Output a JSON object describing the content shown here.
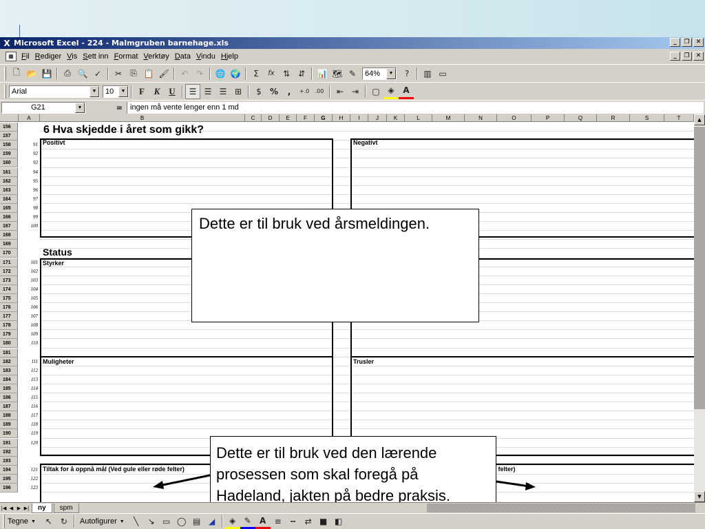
{
  "window": {
    "title": "Microsoft Excel - 224 - Malmgruben barnehage.xls",
    "minimize": "_",
    "restore": "❐",
    "close": "✕"
  },
  "menu": {
    "items": [
      "Fil",
      "Rediger",
      "Vis",
      "Sett inn",
      "Format",
      "Verktøy",
      "Data",
      "Vindu",
      "Hjelp"
    ]
  },
  "toolbar": {
    "zoom": "64%",
    "sum": "Σ",
    "fx": "fx"
  },
  "formatting": {
    "font": "Arial",
    "size": "10",
    "bold": "F",
    "italic": "K",
    "underline": "U",
    "percent": "%",
    "comma": ","
  },
  "formula_bar": {
    "cell_ref": "G21",
    "equals": "=",
    "value": "ingen må vente lenger enn 1 md"
  },
  "columns": [
    "A",
    "B",
    "C",
    "D",
    "E",
    "F",
    "G",
    "H",
    "I",
    "J",
    "K",
    "L",
    "M",
    "N",
    "O",
    "P",
    "Q",
    "R",
    "S",
    "T"
  ],
  "rows": [
    {
      "n": "156",
      "a": ""
    },
    {
      "n": "157",
      "a": ""
    },
    {
      "n": "158",
      "a": "91"
    },
    {
      "n": "159",
      "a": "92"
    },
    {
      "n": "160",
      "a": "93"
    },
    {
      "n": "161",
      "a": "94"
    },
    {
      "n": "162",
      "a": "95"
    },
    {
      "n": "163",
      "a": "96"
    },
    {
      "n": "164",
      "a": "97"
    },
    {
      "n": "165",
      "a": "98"
    },
    {
      "n": "166",
      "a": "99"
    },
    {
      "n": "167",
      "a": "100"
    },
    {
      "n": "168",
      "a": ""
    },
    {
      "n": "169",
      "a": ""
    },
    {
      "n": "170",
      "a": ""
    },
    {
      "n": "171",
      "a": "101"
    },
    {
      "n": "172",
      "a": "102"
    },
    {
      "n": "173",
      "a": "103"
    },
    {
      "n": "174",
      "a": "104"
    },
    {
      "n": "175",
      "a": "105"
    },
    {
      "n": "176",
      "a": "106"
    },
    {
      "n": "177",
      "a": "107"
    },
    {
      "n": "178",
      "a": "108"
    },
    {
      "n": "179",
      "a": "109"
    },
    {
      "n": "180",
      "a": "110"
    },
    {
      "n": "181",
      "a": ""
    },
    {
      "n": "182",
      "a": "111"
    },
    {
      "n": "183",
      "a": "112"
    },
    {
      "n": "184",
      "a": "113"
    },
    {
      "n": "185",
      "a": "114"
    },
    {
      "n": "186",
      "a": "115"
    },
    {
      "n": "187",
      "a": "116"
    },
    {
      "n": "188",
      "a": "117"
    },
    {
      "n": "189",
      "a": "118"
    },
    {
      "n": "190",
      "a": "119"
    },
    {
      "n": "191",
      "a": "120"
    },
    {
      "n": "192",
      "a": ""
    },
    {
      "n": "193",
      "a": ""
    },
    {
      "n": "194",
      "a": "121"
    },
    {
      "n": "195",
      "a": "122"
    },
    {
      "n": "196",
      "a": "123"
    }
  ],
  "sheet": {
    "heading_main": "6  Hva skjedde i året som gikk?",
    "positivt": "Positivt",
    "negativt": "Negativt",
    "status": "Status",
    "styrker": "Styrker",
    "muligheter": "Muligheter",
    "trusler": "Trusler",
    "tiltak": "Tiltak for å oppnå mål (Ved gule eller røde felter)",
    "tiltak_right": "e felter)"
  },
  "callouts": {
    "first": "Dette er til bruk ved årsmeldingen.",
    "second": "Dette er til bruk ved den lærende prosessen som skal foregå på Hadeland, jakten på bedre praksis."
  },
  "tabs": {
    "active": "ny",
    "other": "spm"
  },
  "drawing": {
    "draw": "Tegne",
    "autoshapes": "Autofigurer"
  }
}
